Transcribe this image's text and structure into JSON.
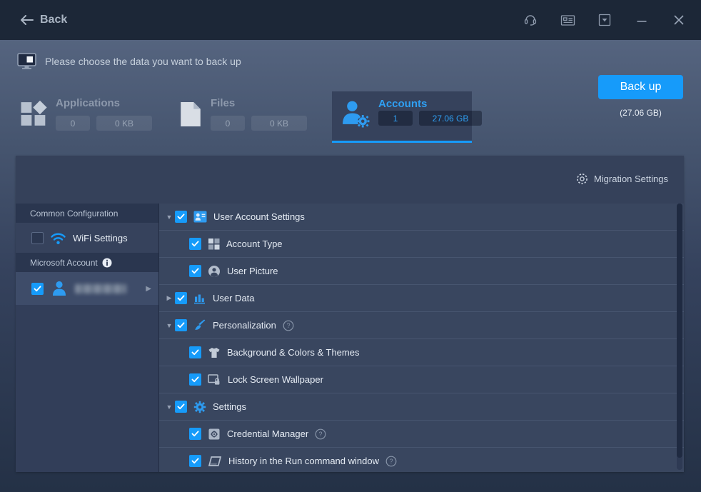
{
  "topbar": {
    "back_label": "Back"
  },
  "header": {
    "message": "Please choose the data you want to back up"
  },
  "tabs": {
    "applications": {
      "label": "Applications",
      "count": "0",
      "size": "0 KB",
      "selected": false
    },
    "files": {
      "label": "Files",
      "count": "0",
      "size": "0 KB",
      "selected": false
    },
    "accounts": {
      "label": "Accounts",
      "count": "1",
      "size": "27.06 GB",
      "selected": true
    }
  },
  "backup": {
    "button_label": "Back up",
    "total_size": "(27.06 GB)"
  },
  "panel": {
    "migration_settings_label": "Migration Settings"
  },
  "sidebar": {
    "common_section_title": "Common Configuration",
    "wifi_label": "WiFi Settings",
    "wifi_checked": false,
    "account_section_title": "Microsoft Account",
    "account_checked": true,
    "account_name_obscured": true
  },
  "tree": [
    {
      "label": "User Account Settings",
      "level": 0,
      "expanded": true,
      "checked": true,
      "icon": "user-card-icon"
    },
    {
      "label": "Account Type",
      "level": 1,
      "checked": true,
      "icon": "grid-icon"
    },
    {
      "label": "User Picture",
      "level": 1,
      "checked": true,
      "icon": "user-circle-icon"
    },
    {
      "label": "User Data",
      "level": 0,
      "expanded": false,
      "checked": true,
      "icon": "bar-chart-icon"
    },
    {
      "label": "Personalization",
      "level": 0,
      "expanded": true,
      "checked": true,
      "icon": "brush-icon",
      "help": true
    },
    {
      "label": "Background & Colors & Themes",
      "level": 1,
      "checked": true,
      "icon": "shirt-icon"
    },
    {
      "label": "Lock Screen Wallpaper",
      "level": 1,
      "checked": true,
      "icon": "lock-screen-icon"
    },
    {
      "label": "Settings",
      "level": 0,
      "expanded": true,
      "checked": true,
      "icon": "gear-icon"
    },
    {
      "label": "Credential Manager",
      "level": 1,
      "checked": true,
      "icon": "safe-icon",
      "help": true
    },
    {
      "label": "History in the Run command window",
      "level": 1,
      "checked": true,
      "icon": "run-window-icon",
      "help": true
    }
  ],
  "glyphs": {
    "expanded_arrow": "▼",
    "collapsed_arrow": "▶",
    "row_caret": "▶"
  },
  "colors": {
    "accent": "#169bfa",
    "topbar_bg": "#1c2737",
    "panel_bg": "#35415a",
    "tab_selected_text": "#2f9ff2"
  }
}
